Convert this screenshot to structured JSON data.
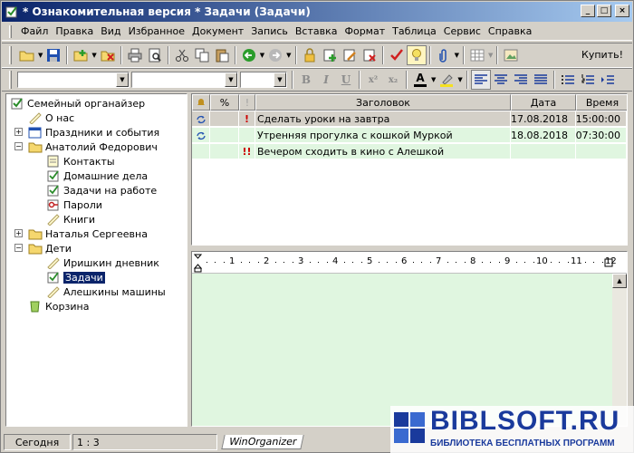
{
  "window": {
    "title": "* Ознакомительная версия * Задачи (Задачи)",
    "btn_min": "_",
    "btn_max": "□",
    "btn_close": "×"
  },
  "menu": [
    "Файл",
    "Правка",
    "Вид",
    "Избранное",
    "Документ",
    "Запись",
    "Вставка",
    "Формат",
    "Таблица",
    "Сервис",
    "Справка"
  ],
  "toolbar": {
    "buy_label": "Купить!"
  },
  "format_toolbar": {
    "bold": "B",
    "italic": "I",
    "underline": "U",
    "superscript": "x²",
    "subscript": "x₂",
    "font_color": "A"
  },
  "tree": {
    "nodes": [
      {
        "label": "Семейный органайзер"
      },
      {
        "label": "О нас"
      },
      {
        "label": "Праздники и события"
      },
      {
        "label": "Анатолий Федорович"
      },
      {
        "label": "Контакты"
      },
      {
        "label": "Домашние дела"
      },
      {
        "label": "Задачи на работе"
      },
      {
        "label": "Пароли"
      },
      {
        "label": "Книги"
      },
      {
        "label": "Наталья Сергеевна"
      },
      {
        "label": "Дети"
      },
      {
        "label": "Иришкин дневник"
      },
      {
        "label": "Задачи"
      },
      {
        "label": "Алешкины машины"
      },
      {
        "label": "Корзина"
      }
    ],
    "plus": "+",
    "minus": "−"
  },
  "grid": {
    "columns": {
      "percent": "%",
      "priority": "!",
      "title": "Заголовок",
      "date": "Дата",
      "time": "Время"
    },
    "rows": [
      {
        "priority": "!",
        "title": "Сделать уроки на завтра",
        "date": "17.08.2018",
        "time": "15:00:00"
      },
      {
        "priority": "",
        "title": "Утренняя прогулка с кошкой Муркой",
        "date": "18.08.2018",
        "time": "07:30:00"
      },
      {
        "priority": "!!",
        "title": "Вечером сходить в кино с Алешкой",
        "date": "",
        "time": ""
      }
    ]
  },
  "ruler": {
    "marks": [
      "1",
      "2",
      "3",
      "4",
      "5",
      "6",
      "7",
      "8",
      "9",
      "10",
      "11",
      "12"
    ]
  },
  "status": {
    "today": "Сегодня",
    "position": "1 : 3",
    "tab": "WinOrganizer"
  },
  "watermark": {
    "brand": "BIBLSOFT.RU",
    "tagline": "БИБЛИОТЕКА БЕСПЛАТНЫХ ПРОГРАММ"
  },
  "colors": {
    "title_start": "#0a246a",
    "title_end": "#a6caf0",
    "grid_row": "#e0f6e0",
    "selected": "#0a246a",
    "priority": "#cc0000",
    "watermark_blue": "#1a3a9c"
  }
}
